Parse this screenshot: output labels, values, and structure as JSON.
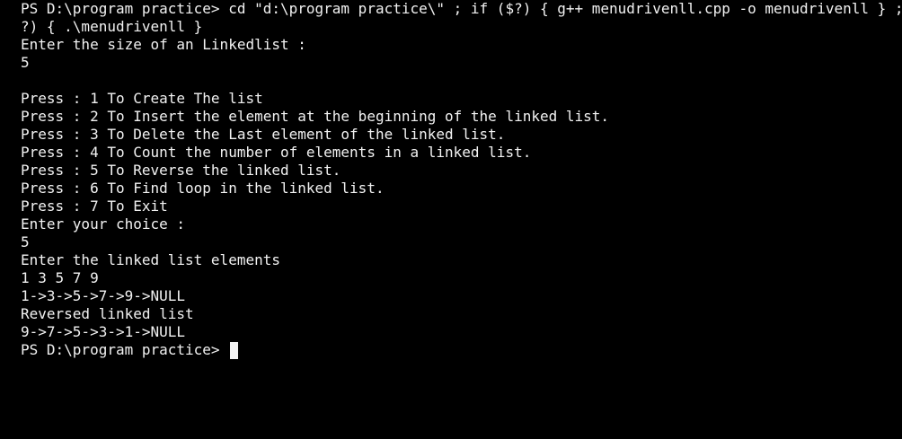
{
  "terminal": {
    "lines": [
      "PS D:\\program practice> cd \"d:\\program practice\\\" ; if ($?) { g++ menudrivenll.cpp -o menudrivenll } ; if ($",
      "?) { .\\menudrivenll }",
      "Enter the size of an Linkedlist :",
      "5",
      "",
      "Press : 1 To Create The list",
      "Press : 2 To Insert the element at the beginning of the linked list.",
      "Press : 3 To Delete the Last element of the linked list.",
      "Press : 4 To Count the number of elements in a linked list.",
      "Press : 5 To Reverse the linked list.",
      "Press : 6 To Find loop in the linked list.",
      "Press : 7 To Exit",
      "Enter your choice :",
      "5",
      "Enter the linked list elements",
      "1 3 5 7 9",
      "1->3->5->7->9->NULL",
      "Reversed linked list",
      "9->7->5->3->1->NULL"
    ],
    "prompt": "PS D:\\program practice> "
  }
}
